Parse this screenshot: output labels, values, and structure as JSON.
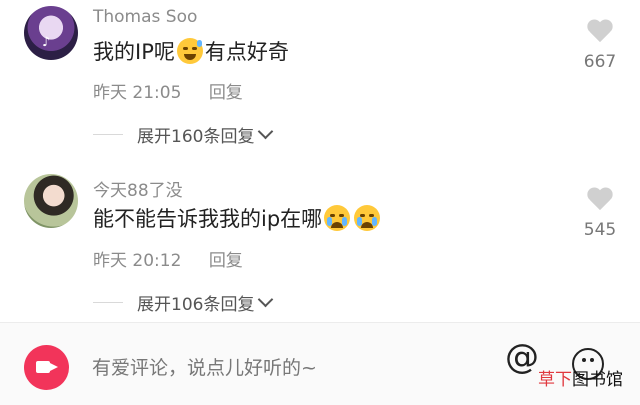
{
  "comments": [
    {
      "username": "Thomas Soo",
      "text_before": "我的IP呢",
      "emoji": "grinning-sweat-emoji",
      "text_after": "有点好奇",
      "time": "昨天 21:05",
      "reply_label": "回复",
      "expand_label": "展开160条回复",
      "like_count": "667"
    },
    {
      "username": "今天88了没",
      "text_before": "能不能告诉我我的ip在哪",
      "emoji": "crying-emoji",
      "time": "昨天 20:12",
      "reply_label": "回复",
      "expand_label": "展开106条回复",
      "like_count": "545"
    }
  ],
  "bottom_bar": {
    "placeholder": "有爱评论，说点儿好听的~",
    "camera_icon": "camera-icon",
    "mention_icon": "@",
    "emoji_icon": "emoji-face-icon"
  },
  "watermark": {
    "part_a": "草下",
    "part_b": "图书馆"
  },
  "colors": {
    "accent": "#f2345a",
    "heart": "#d0d0d0",
    "emoji": "#ffc93a"
  }
}
